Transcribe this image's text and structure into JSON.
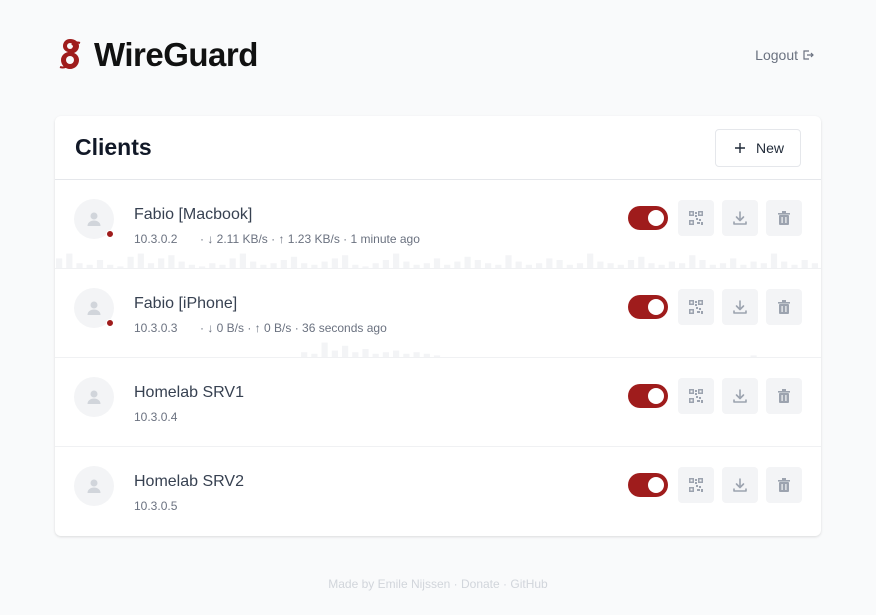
{
  "app": {
    "title": "WireGuard",
    "logout_label": "Logout",
    "accent_color": "#9f1c1c"
  },
  "clients_card": {
    "title": "Clients",
    "new_label": "New",
    "clients": [
      {
        "name": "Fabio [Macbook]",
        "ip": "10.3.0.2",
        "stats": "· ↓ 2.11 KB/s · ↑ 1.23 KB/s · 1 minute ago",
        "online": true,
        "enabled": true,
        "activity": [
          0.6,
          0.9,
          0.3,
          0.2,
          0.5,
          0.2,
          0.1,
          0.7,
          0.9,
          0.3,
          0.6,
          0.8,
          0.4,
          0.2,
          0.1,
          0.3,
          0.2,
          0.6,
          0.9,
          0.4,
          0.2,
          0.3,
          0.5,
          0.7,
          0.3,
          0.2,
          0.4,
          0.6,
          0.8,
          0.2,
          0.1,
          0.3,
          0.5,
          0.9,
          0.4,
          0.2,
          0.3,
          0.6,
          0.2,
          0.4,
          0.7,
          0.5,
          0.3,
          0.2,
          0.8,
          0.4,
          0.2,
          0.3,
          0.6,
          0.5,
          0.2,
          0.3,
          0.9,
          0.4,
          0.3,
          0.2,
          0.5,
          0.7,
          0.3,
          0.2,
          0.4,
          0.3,
          0.8,
          0.5,
          0.2,
          0.3,
          0.6,
          0.2,
          0.4,
          0.3,
          0.9,
          0.4,
          0.2,
          0.5,
          0.3
        ]
      },
      {
        "name": "Fabio [iPhone]",
        "ip": "10.3.0.3",
        "stats": "· ↓ 0 B/s · ↑ 0 B/s · 36 seconds ago",
        "online": true,
        "enabled": true,
        "activity": [
          0,
          0,
          0,
          0,
          0,
          0,
          0,
          0,
          0,
          0,
          0,
          0,
          0,
          0,
          0,
          0,
          0,
          0,
          0,
          0,
          0,
          0,
          0,
          0,
          0.3,
          0.2,
          0.9,
          0.4,
          0.7,
          0.3,
          0.5,
          0.2,
          0.3,
          0.4,
          0.2,
          0.3,
          0.2,
          0.1,
          0,
          0,
          0,
          0,
          0,
          0,
          0,
          0,
          0,
          0,
          0,
          0,
          0,
          0,
          0,
          0,
          0,
          0,
          0,
          0,
          0,
          0,
          0,
          0,
          0,
          0,
          0,
          0,
          0,
          0,
          0.1,
          0,
          0,
          0,
          0,
          0,
          0
        ]
      },
      {
        "name": "Homelab SRV1",
        "ip": "10.3.0.4",
        "stats": "",
        "online": false,
        "enabled": true,
        "activity": []
      },
      {
        "name": "Homelab SRV2",
        "ip": "10.3.0.5",
        "stats": "",
        "online": false,
        "enabled": true,
        "activity": []
      }
    ]
  },
  "icons": {
    "logo": "wireguard-dragon-icon",
    "logout": "logout-arrow-icon",
    "new": "plus-icon",
    "avatar": "user-silhouette-icon",
    "qr": "qr-code-icon",
    "download": "download-icon",
    "delete": "trash-icon"
  },
  "footer": {
    "made_by": "Made by Emile Nijssen",
    "sep": " · ",
    "donate": "Donate",
    "github": "GitHub"
  }
}
